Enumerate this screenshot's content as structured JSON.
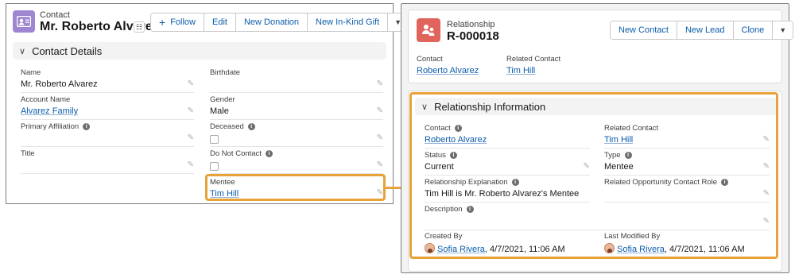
{
  "contact": {
    "object_type": "Contact",
    "name": "Mr. Roberto Alvarez",
    "hierarchy_glyph": "☷",
    "actions": {
      "follow": "Follow",
      "edit": "Edit",
      "new_donation": "New Donation",
      "new_inkind_gift": "New In-Kind Gift"
    },
    "section_title": "Contact Details",
    "fields": {
      "name": {
        "label": "Name",
        "value": "Mr. Roberto Alvarez"
      },
      "birthdate": {
        "label": "Birthdate",
        "value": ""
      },
      "account_name": {
        "label": "Account Name",
        "value": "Alvarez Family"
      },
      "gender": {
        "label": "Gender",
        "value": "Male"
      },
      "primary_affiliation": {
        "label": "Primary Affiliation",
        "value": ""
      },
      "deceased": {
        "label": "Deceased",
        "value": ""
      },
      "title": {
        "label": "Title",
        "value": ""
      },
      "do_not_contact": {
        "label": "Do Not Contact",
        "value": ""
      },
      "mentee": {
        "label": "Mentee",
        "value": "Tim Hill"
      }
    }
  },
  "relationship": {
    "object_type": "Relationship",
    "name": "R-000018",
    "actions": {
      "new_contact": "New Contact",
      "new_lead": "New Lead",
      "clone": "Clone"
    },
    "highlights": {
      "contact": {
        "label": "Contact",
        "value": "Roberto Alvarez"
      },
      "related_contact": {
        "label": "Related Contact",
        "value": "Tim Hill"
      }
    },
    "section_title": "Relationship Information",
    "fields": {
      "contact": {
        "label": "Contact",
        "value": "Roberto Alvarez"
      },
      "related_contact": {
        "label": "Related Contact",
        "value": "Tim Hill"
      },
      "status": {
        "label": "Status",
        "value": "Current"
      },
      "type": {
        "label": "Type",
        "value": "Mentee"
      },
      "relationship_explanation": {
        "label": "Relationship Explanation",
        "value": "Tim Hill is Mr. Roberto Alvarez's Mentee"
      },
      "related_opportunity_contact_role": {
        "label": "Related Opportunity Contact Role",
        "value": ""
      },
      "description": {
        "label": "Description",
        "value": ""
      },
      "created_by": {
        "label": "Created By",
        "user": "Sofia Rivera",
        "date": ", 4/7/2021, 11:06 AM"
      },
      "last_modified_by": {
        "label": "Last Modified By",
        "user": "Sofia Rivera",
        "date": ", 4/7/2021, 11:06 AM"
      }
    }
  },
  "colors": {
    "contact_icon": "#9e86d0",
    "relationship_icon": "#e0645b",
    "link": "#0b5cab",
    "highlight": "#e8a23a"
  },
  "icons": {
    "info": "i",
    "pencil": "✎",
    "chevron": "∨",
    "menu": "▼",
    "plus": "+"
  }
}
